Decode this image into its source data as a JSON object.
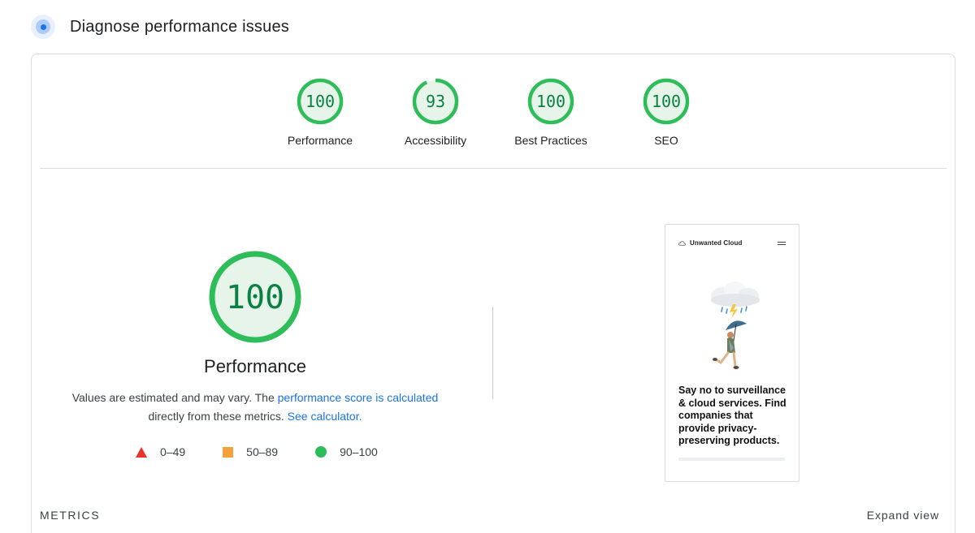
{
  "header": {
    "title": "Diagnose performance issues",
    "logo_icon": "lighthouse-target-icon"
  },
  "categories": [
    {
      "label": "Performance",
      "score": "100",
      "value": 100
    },
    {
      "label": "Accessibility",
      "score": "93",
      "value": 93
    },
    {
      "label": "Best Practices",
      "score": "100",
      "value": 100
    },
    {
      "label": "SEO",
      "score": "100",
      "value": 100
    }
  ],
  "performance": {
    "score": "100",
    "value": 100,
    "label": "Performance",
    "desc_prefix": "Values are estimated and may vary. The ",
    "desc_link1": "performance score is calculated",
    "desc_middle": " directly from these metrics. ",
    "desc_link2": "See calculator."
  },
  "legend": [
    {
      "icon": "red-triangle-icon",
      "range": "0–49"
    },
    {
      "icon": "orange-square-icon",
      "range": "50–89"
    },
    {
      "icon": "green-circle-icon",
      "range": "90–100"
    }
  ],
  "screenshot": {
    "brand": "Unwanted Cloud",
    "headline": "Say no to surveillance & cloud services. Find companies that provide privacy-preserving products."
  },
  "footer": {
    "metrics_title": "METRICS",
    "expand_view": "Expand view"
  },
  "colors": {
    "pass": "#0b8043",
    "pass_ring": "#2ebd59",
    "pass_fill": "#e6f4ea",
    "fail": "#e8332b",
    "average": "#f4a23b",
    "link": "#1a73e8"
  }
}
